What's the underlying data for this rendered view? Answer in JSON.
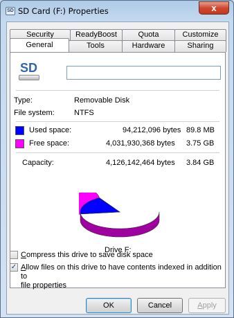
{
  "window": {
    "title": "SD Card (F:) Properties",
    "icon_text": "SD",
    "close_label": "x"
  },
  "tabs": {
    "top": [
      "Security",
      "ReadyBoost",
      "Quota",
      "Customize"
    ],
    "bottom": [
      "General",
      "Tools",
      "Hardware",
      "Sharing"
    ],
    "active": "General"
  },
  "general": {
    "icon_text": "SD",
    "name_value": "",
    "type_label": "Type:",
    "type_value": "Removable Disk",
    "fs_label": "File system:",
    "fs_value": "NTFS",
    "used_label": "Used space:",
    "used_bytes": "94,212,096 bytes",
    "used_size": "89.8 MB",
    "free_label": "Free space:",
    "free_bytes": "4,031,930,368 bytes",
    "free_size": "3.75 GB",
    "capacity_label": "Capacity:",
    "capacity_bytes": "4,126,142,464 bytes",
    "capacity_size": "3.84 GB",
    "drive_label": "Drive F:",
    "used_fraction": 0.0228,
    "used_color": "#0000ff",
    "free_color": "#ff00ff"
  },
  "options": {
    "compress": {
      "label_u": "C",
      "label_rest": "ompress this drive to save disk space",
      "checked": false
    },
    "index": {
      "label_u": "A",
      "label_rest": "llow files on this drive to have contents indexed in addition to",
      "label_line2": "file properties",
      "checked": true
    }
  },
  "buttons": {
    "ok": "OK",
    "cancel": "Cancel",
    "apply_u": "A",
    "apply_rest": "pply"
  }
}
